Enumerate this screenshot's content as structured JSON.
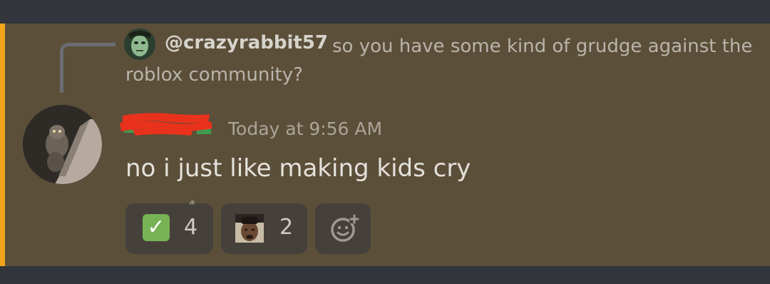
{
  "reply": {
    "username": "@crazyrabbit57",
    "text": "so you have some kind of grudge against the roblox community?"
  },
  "message": {
    "timestamp": "Today at 9:56 AM",
    "content": "no i just like making kids cry"
  },
  "reactions": [
    {
      "emoji": "white-check-mark",
      "glyph": "✓",
      "count": "4"
    },
    {
      "emoji": "custom-face-image",
      "count": "2"
    }
  ],
  "add_reaction_icon": "add-reaction-icon",
  "colors": {
    "background": "#32353b",
    "mention_highlight": "#5b4f3a",
    "mention_bar": "#f0a51b",
    "redaction": "#e8321b",
    "check_green": "#77b255"
  }
}
